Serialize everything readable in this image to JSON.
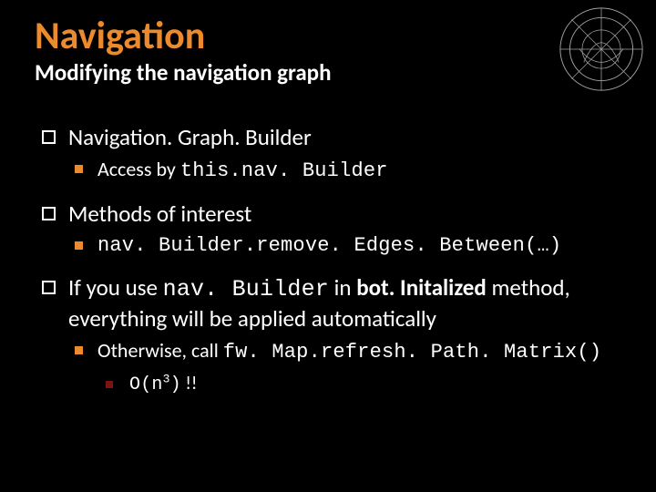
{
  "header": {
    "title": "Navigation",
    "subtitle": "Modifying the navigation graph"
  },
  "logo": {
    "name": "university-seal"
  },
  "bullets": {
    "b1": {
      "text": "Navigation. Graph. Builder",
      "sub": {
        "a_pre": "Access by ",
        "a_code": "this.nav. Builder"
      }
    },
    "b2": {
      "text": "Methods of interest",
      "sub": {
        "a_code": "nav. Builder.remove. Edges. Between(…)"
      }
    },
    "b3": {
      "pre": "If you use ",
      "code": "nav. Builder",
      "mid": " in ",
      "bold": "bot. Initalized",
      "post": " method, everything will be applied automatically",
      "sub": {
        "a_pre": "Otherwise, call ",
        "a_code": "fw. Map.refresh. Path. Matrix()",
        "subsub": {
          "code_pre": "O(n",
          "sup": "3",
          "code_post": ")",
          "after": " !!"
        }
      }
    }
  }
}
